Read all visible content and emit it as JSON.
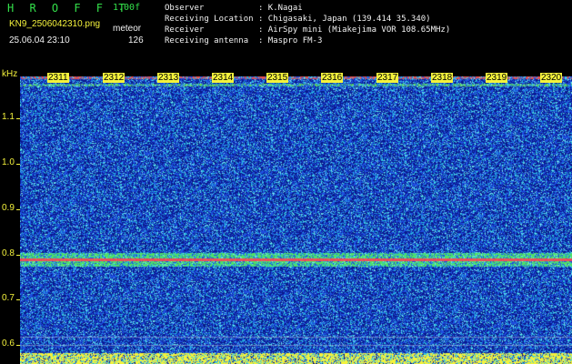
{
  "header": {
    "app_name": "H R O F F T",
    "version": "1.00f",
    "filename": "KN9_2506042310.png",
    "datetime": "25.06.04 23:10",
    "meteor_label": "meteor",
    "meteor_count": "126",
    "info_lines": [
      "Observer           : K.Nagai",
      "Receiving Location : Chigasaki, Japan (139.414 35.340)",
      "Receiver           : AirSpy mini (Miakejima VOR 108.65MHz)",
      "Receiving antenna  : Maspro FM-3"
    ]
  },
  "axis": {
    "y_unit": "kHz",
    "y_ticks": [
      "1.1",
      "1.0",
      "0.9",
      "0.8",
      "0.7",
      "0.6"
    ],
    "x_ticks": [
      "2311",
      "2312",
      "2313",
      "2314",
      "2315",
      "2316",
      "2317",
      "2318",
      "2319",
      "2320"
    ]
  },
  "colors": {
    "noise_dark": "#0a1c8c",
    "noise_mid": "#1f4fe0",
    "noise_light": "#2ec8d8",
    "signal_band": "#e84060",
    "signal_green": "#58e060",
    "bottom_bar": "#f4f23c"
  }
}
